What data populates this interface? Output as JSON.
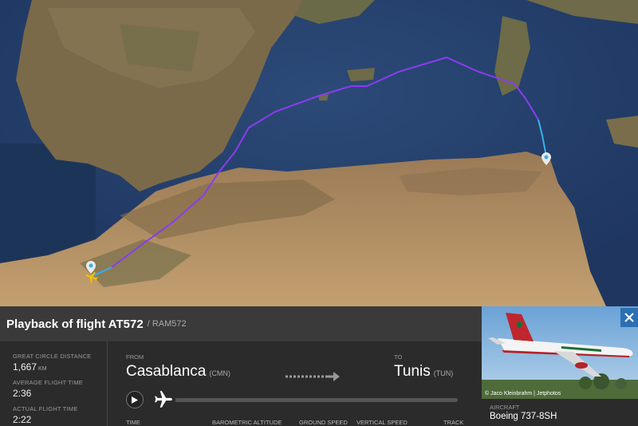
{
  "flight": {
    "title": "Playback of flight AT572",
    "callsign": "/ RAM572"
  },
  "stats": {
    "distance_label": "GREAT CIRCLE DISTANCE",
    "distance_value": "1,667",
    "distance_unit": "KM",
    "avg_label": "AVERAGE FLIGHT TIME",
    "avg_value": "2:36",
    "actual_label": "ACTUAL FLIGHT TIME",
    "actual_value": "2:22"
  },
  "route": {
    "from_label": "FROM",
    "from_city": "Casablanca",
    "from_code": "(CMN)",
    "to_label": "TO",
    "to_city": "Tunis",
    "to_code": "(TUN)"
  },
  "columns": [
    "TIME",
    "BAROMETRIC ALTITUDE",
    "GROUND SPEED",
    "VERTICAL SPEED",
    "TRACK"
  ],
  "aircraft": {
    "label": "AIRCRAFT",
    "value": "Boeing 737-8SH",
    "photo_credit": "© Jaco Kleinbrahm | Jetphotos"
  },
  "icons": {
    "play": "play-icon",
    "plane": "airplane-icon",
    "close": "close-icon",
    "arrow": "arrow-right-icon",
    "marker": "map-pin-icon"
  },
  "colors": {
    "track_purple": "#8a3cf0",
    "track_blue": "#3ab0e8",
    "close_bg": "#2d6fb3"
  }
}
